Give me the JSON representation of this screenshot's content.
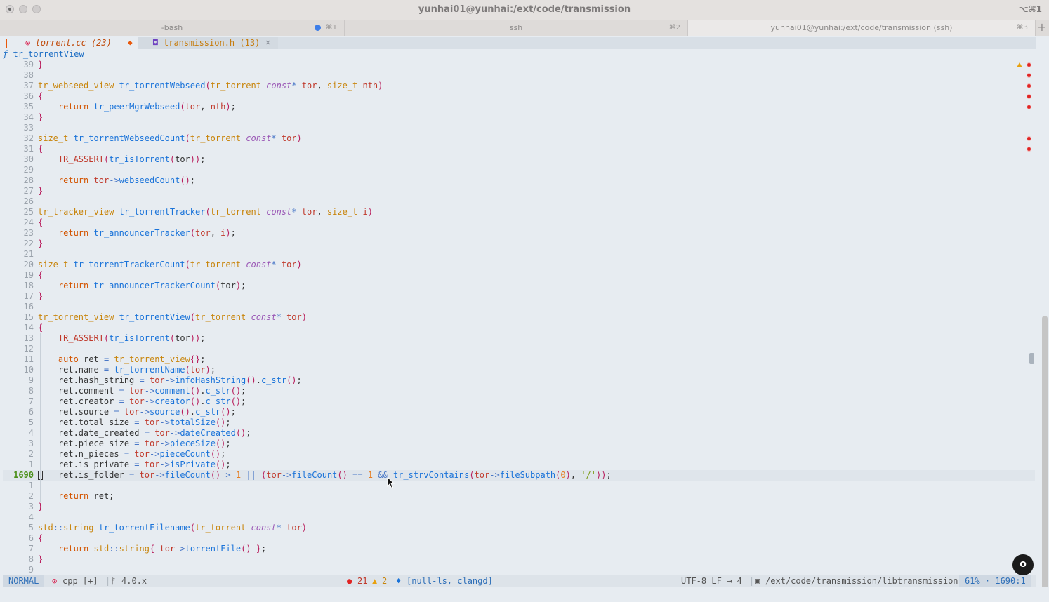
{
  "window": {
    "title": "yunhai01@yunhai:/ext/code/transmission",
    "shortcut": "⌥⌘1"
  },
  "terminal_tabs": [
    {
      "label": "-bash",
      "shortcut": "⌘1"
    },
    {
      "label": "ssh",
      "shortcut": "⌘2"
    },
    {
      "label": "yunhai01@yunhai:/ext/code/transmission (ssh)",
      "shortcut": "⌘3"
    }
  ],
  "new_tab_label": "+",
  "buffers": {
    "active_icon": "⊙",
    "active_label": "torrent.cc (23)",
    "modified_marker": "◆",
    "second_icon": "◘",
    "second_label": "transmission.h (13)",
    "close_label": "✕"
  },
  "winbar": {
    "prefix": "ƒ",
    "label": "tr_torrentView"
  },
  "code_lines": [
    {
      "n": "39",
      "h": "<span class='br'>}</span>"
    },
    {
      "n": "38",
      "h": ""
    },
    {
      "n": "37",
      "h": "<span class='ty'>tr_webseed_view</span> <span class='fn'>tr_torrentWebseed</span><span class='br'>(</span><span class='ty'>tr_torrent</span> <span class='q'>const</span><span class='op'>*</span> <span class='id'>tor</span>, <span class='ty'>size_t</span> <span class='id'>nth</span><span class='br'>)</span>"
    },
    {
      "n": "36",
      "h": "<span class='br'>{</span>"
    },
    {
      "n": "35",
      "h": "    <span class='k'>return</span> <span class='fn'>tr_peerMgrWebseed</span><span class='br'>(</span><span class='id'>tor</span>, <span class='id'>nth</span><span class='br'>)</span>;"
    },
    {
      "n": "34",
      "h": "<span class='br'>}</span>"
    },
    {
      "n": "33",
      "h": ""
    },
    {
      "n": "32",
      "h": "<span class='ty'>size_t</span> <span class='fn'>tr_torrentWebseedCount</span><span class='br'>(</span><span class='ty'>tr_torrent</span> <span class='q'>const</span><span class='op'>*</span> <span class='id'>tor</span><span class='br'>)</span>"
    },
    {
      "n": "31",
      "h": "<span class='br'>{</span>"
    },
    {
      "n": "30",
      "h": "    <span class='mac'>TR_ASSERT</span><span class='br'>(</span><span class='fn'>tr_isTorrent</span><span class='br'>(</span>tor<span class='br'>))</span>;"
    },
    {
      "n": "29",
      "h": ""
    },
    {
      "n": "28",
      "h": "    <span class='k'>return</span> <span class='id'>tor</span><span class='op'>-&gt;</span><span class='fn'>webseedCount</span><span class='br'>()</span>;"
    },
    {
      "n": "27",
      "h": "<span class='br'>}</span>"
    },
    {
      "n": "26",
      "h": ""
    },
    {
      "n": "25",
      "h": "<span class='ty'>tr_tracker_view</span> <span class='fn'>tr_torrentTracker</span><span class='br'>(</span><span class='ty'>tr_torrent</span> <span class='q'>const</span><span class='op'>*</span> <span class='id'>tor</span>, <span class='ty'>size_t</span> <span class='id'>i</span><span class='br'>)</span>"
    },
    {
      "n": "24",
      "h": "<span class='br'>{</span>"
    },
    {
      "n": "23",
      "h": "    <span class='k'>return</span> <span class='fn'>tr_announcerTracker</span><span class='br'>(</span><span class='id'>tor</span>, <span class='id'>i</span><span class='br'>)</span>;"
    },
    {
      "n": "22",
      "h": "<span class='br'>}</span>"
    },
    {
      "n": "21",
      "h": ""
    },
    {
      "n": "20",
      "h": "<span class='ty'>size_t</span> <span class='fn'>tr_torrentTrackerCount</span><span class='br'>(</span><span class='ty'>tr_torrent</span> <span class='q'>const</span><span class='op'>*</span> <span class='id'>tor</span><span class='br'>)</span>"
    },
    {
      "n": "19",
      "h": "<span class='br'>{</span>"
    },
    {
      "n": "18",
      "h": "    <span class='k'>return</span> <span class='fn'>tr_announcerTrackerCount</span><span class='br'>(</span>tor<span class='br'>)</span>;"
    },
    {
      "n": "17",
      "h": "<span class='br'>}</span>"
    },
    {
      "n": "16",
      "h": ""
    },
    {
      "n": "15",
      "h": "<span class='ty'>tr_torrent_view</span> <span class='fn'>tr_torrentView</span><span class='br'>(</span><span class='ty'>tr_torrent</span> <span class='q'>const</span><span class='op'>*</span> <span class='id'>tor</span><span class='br'>)</span>"
    },
    {
      "n": "14",
      "h": "<span class='br'>{</span>"
    },
    {
      "n": "13",
      "h": "    <span class='mac'>TR_ASSERT</span><span class='br'>(</span><span class='fn'>tr_isTorrent</span><span class='br'>(</span>tor<span class='br'>))</span>;"
    },
    {
      "n": "12",
      "h": ""
    },
    {
      "n": "11",
      "h": "    <span class='k'>auto</span> ret <span class='op'>=</span> <span class='ty'>tr_torrent_view</span><span class='br'>{}</span>;"
    },
    {
      "n": "10",
      "h": "    ret.name <span class='op'>=</span> <span class='fn'>tr_torrentName</span><span class='br'>(</span><span class='id'>tor</span><span class='br'>)</span>;"
    },
    {
      "n": "9",
      "h": "    ret.hash_string <span class='op'>=</span> <span class='id'>tor</span><span class='op'>-&gt;</span><span class='fn'>infoHashString</span><span class='br'>()</span>.<span class='fn'>c_str</span><span class='br'>()</span>;"
    },
    {
      "n": "8",
      "h": "    ret.comment <span class='op'>=</span> <span class='id'>tor</span><span class='op'>-&gt;</span><span class='fn'>comment</span><span class='br'>()</span>.<span class='fn'>c_str</span><span class='br'>()</span>;"
    },
    {
      "n": "7",
      "h": "    ret.creator <span class='op'>=</span> <span class='id'>tor</span><span class='op'>-&gt;</span><span class='fn'>creator</span><span class='br'>()</span>.<span class='fn'>c_str</span><span class='br'>()</span>;"
    },
    {
      "n": "6",
      "h": "    ret.source <span class='op'>=</span> <span class='id'>tor</span><span class='op'>-&gt;</span><span class='fn'>source</span><span class='br'>()</span>.<span class='fn'>c_str</span><span class='br'>()</span>;"
    },
    {
      "n": "5",
      "h": "    ret.total_size <span class='op'>=</span> <span class='id'>tor</span><span class='op'>-&gt;</span><span class='fn'>totalSize</span><span class='br'>()</span>;"
    },
    {
      "n": "4",
      "h": "    ret.date_created <span class='op'>=</span> <span class='id'>tor</span><span class='op'>-&gt;</span><span class='fn'>dateCreated</span><span class='br'>()</span>;"
    },
    {
      "n": "3",
      "h": "    ret.piece_size <span class='op'>=</span> <span class='id'>tor</span><span class='op'>-&gt;</span><span class='fn'>pieceSize</span><span class='br'>()</span>;"
    },
    {
      "n": "2",
      "h": "    ret.n_pieces <span class='op'>=</span> <span class='id'>tor</span><span class='op'>-&gt;</span><span class='fn'>pieceCount</span><span class='br'>()</span>;"
    },
    {
      "n": "1",
      "h": "    ret.is_private <span class='op'>=</span> <span class='id'>tor</span><span class='op'>-&gt;</span><span class='fn'>isPrivate</span><span class='br'>()</span>;"
    },
    {
      "n": "1690",
      "cur": true,
      "h": "    ret.is_folder <span class='op'>=</span> <span class='id'>tor</span><span class='op'>-&gt;</span><span class='fn'>fileCount</span><span class='br'>()</span> <span class='op'>&gt;</span> <span class='nm0'>1</span> <span class='op'>||</span> <span class='br'>(</span><span class='id'>tor</span><span class='op'>-&gt;</span><span class='fn'>fileCount</span><span class='br'>()</span> <span class='op'>==</span> <span class='nm0'>1</span> <span class='op'>&amp;&amp;</span> <span class='fn'>tr_strvContains</span><span class='br'>(</span><span class='id'>tor</span><span class='op'>-&gt;</span><span class='fn'>fileSubpath</span><span class='br'>(</span><span class='nm0'>0</span><span class='br'>)</span>, <span class='st'>'/'</span><span class='br'>))</span>;"
    },
    {
      "n": "1",
      "h": ""
    },
    {
      "n": "2",
      "h": "    <span class='k'>return</span> ret;"
    },
    {
      "n": "3",
      "h": "<span class='br'>}</span>"
    },
    {
      "n": "4",
      "h": ""
    },
    {
      "n": "5",
      "h": "<span class='ty'>std</span><span class='op'>::</span><span class='ty'>string</span> <span class='fn'>tr_torrentFilename</span><span class='br'>(</span><span class='ty'>tr_torrent</span> <span class='q'>const</span><span class='op'>*</span> <span class='id'>tor</span><span class='br'>)</span>"
    },
    {
      "n": "6",
      "h": "<span class='br'>{</span>"
    },
    {
      "n": "7",
      "h": "    <span class='k'>return</span> <span class='ty'>std</span><span class='op'>::</span><span class='ty'>string</span><span class='br'>{</span> <span class='id'>tor</span><span class='op'>-&gt;</span><span class='fn'>torrentFile</span><span class='br'>()</span> <span class='br'>}</span>;"
    },
    {
      "n": "8",
      "h": "<span class='br'>}</span>"
    },
    {
      "n": "9",
      "h": ""
    }
  ],
  "status": {
    "mode": "NORMAL",
    "ft_icon": "⊙",
    "filetype": "cpp [+]",
    "branch_icon": "ᚠ",
    "branch": "4.0.x",
    "err_icon": "●",
    "errors": "21",
    "warn_icon": "▲",
    "warnings": "2",
    "lsp_icon": "♦",
    "lsp": "[null-ls, clangd]",
    "encoding": "UTF-8 LF ⇥ 4",
    "dir_icon": "▣",
    "path": "/ext/code/transmission/libtransmission",
    "position": "61% · 1690:1"
  },
  "float_button_label": "o",
  "colors": {
    "error": "#e02424",
    "warning": "#e8a10e",
    "accent": "#1a73d9"
  }
}
